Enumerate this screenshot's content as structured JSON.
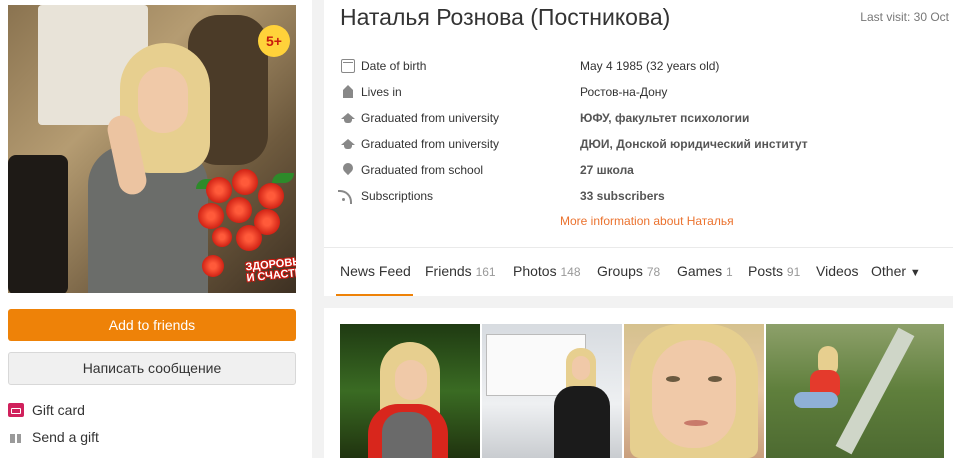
{
  "profile": {
    "name": "Наталья Рознова (Постникова)",
    "last_visit": "Last visit: 30 Oct",
    "badge": "5+",
    "avatar_caption_line1": "ЗДОРОВЬЯ",
    "avatar_caption_line2": "И СЧАСТЬЯ!"
  },
  "actions": {
    "add_friends": "Add to friends",
    "send_message": "Написать сообщение",
    "gift_card": "Gift card",
    "send_gift": "Send a gift"
  },
  "info": [
    {
      "icon": "calendar-icon",
      "label": "Date of birth",
      "value": "May 4 1985 (32 years old)",
      "bold": false
    },
    {
      "icon": "house-icon",
      "label": "Lives in",
      "value": "Ростов-на-Дону",
      "bold": false
    },
    {
      "icon": "graduation-cap-icon",
      "label": "Graduated from university",
      "value": "ЮФУ, факультет психологии",
      "bold": true
    },
    {
      "icon": "graduation-cap-icon",
      "label": "Graduated from university",
      "value": "ДЮИ, Донской юридический институт",
      "bold": true
    },
    {
      "icon": "school-pin-icon",
      "label": "Graduated from school",
      "value": "27 школа",
      "bold": true
    },
    {
      "icon": "rss-icon",
      "label": "Subscriptions",
      "value": "33 subscribers",
      "bold": true
    }
  ],
  "more_info": "More information about Наталья",
  "tabs": [
    {
      "label": "News Feed",
      "count": ""
    },
    {
      "label": "Friends",
      "count": "161"
    },
    {
      "label": "Photos",
      "count": "148"
    },
    {
      "label": "Groups",
      "count": "78"
    },
    {
      "label": "Games",
      "count": "1"
    },
    {
      "label": "Posts",
      "count": "91"
    },
    {
      "label": "Videos",
      "count": ""
    },
    {
      "label": "Other",
      "count": "",
      "caret": "▼"
    }
  ],
  "colors": {
    "accent": "#ee8208",
    "link": "#eb722e",
    "badge": "#ffd23a"
  }
}
